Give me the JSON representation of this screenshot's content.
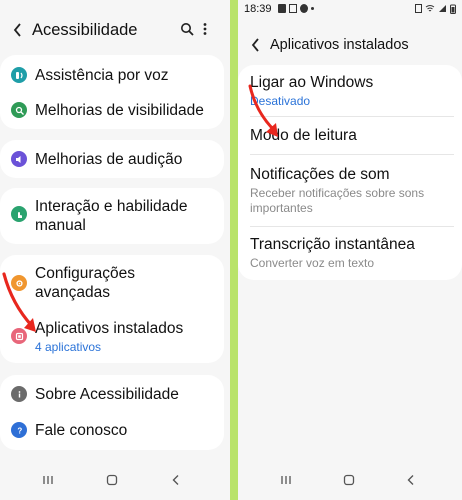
{
  "left": {
    "title": "Acessibilidade",
    "groups": [
      {
        "items": [
          {
            "label": "Assistência por voz",
            "icon": "voice-assistant-icon",
            "color": "#1f9ea8"
          },
          {
            "label": "Melhorias de visibilidade",
            "icon": "visibility-icon",
            "color": "#2f9b57"
          }
        ]
      },
      {
        "items": [
          {
            "label": "Melhorias de audição",
            "icon": "hearing-icon",
            "color": "#6b52d8"
          }
        ]
      },
      {
        "items": [
          {
            "label": "Interação e habilidade",
            "label2": "manual",
            "icon": "interaction-icon",
            "color": "#2aa36f"
          }
        ]
      },
      {
        "items": [
          {
            "label": "Configurações",
            "label2": "avançadas",
            "icon": "advanced-settings-icon",
            "color": "#f0962f"
          },
          {
            "label": "Aplicativos instalados",
            "sub": "4 aplicativos",
            "icon": "installed-apps-icon",
            "color": "#e8667a"
          }
        ]
      },
      {
        "items": [
          {
            "label": "Sobre Acessibilidade",
            "icon": "info-icon",
            "color": "#6b6b6b"
          },
          {
            "label": "Fale conosco",
            "icon": "contact-icon",
            "color": "#2e6fd6"
          }
        ]
      }
    ]
  },
  "right": {
    "status_time": "18:39",
    "title": "Aplicativos instalados",
    "items": [
      {
        "label": "Ligar ao Windows",
        "sub": "Desativado",
        "sub_color": "#2b73d8"
      },
      {
        "label": "Modo de leitura"
      },
      {
        "label": "Notificações de som",
        "sub": "Receber notificações sobre sons importantes",
        "sub_color": "#8a8a8a"
      },
      {
        "label": "Transcrição instantânea",
        "sub": "Converter voz em texto",
        "sub_color": "#8a8a8a"
      }
    ]
  },
  "colors": {
    "accent_arrow": "#e8271e",
    "link": "#2b73d8",
    "background": "#b9e36a"
  }
}
